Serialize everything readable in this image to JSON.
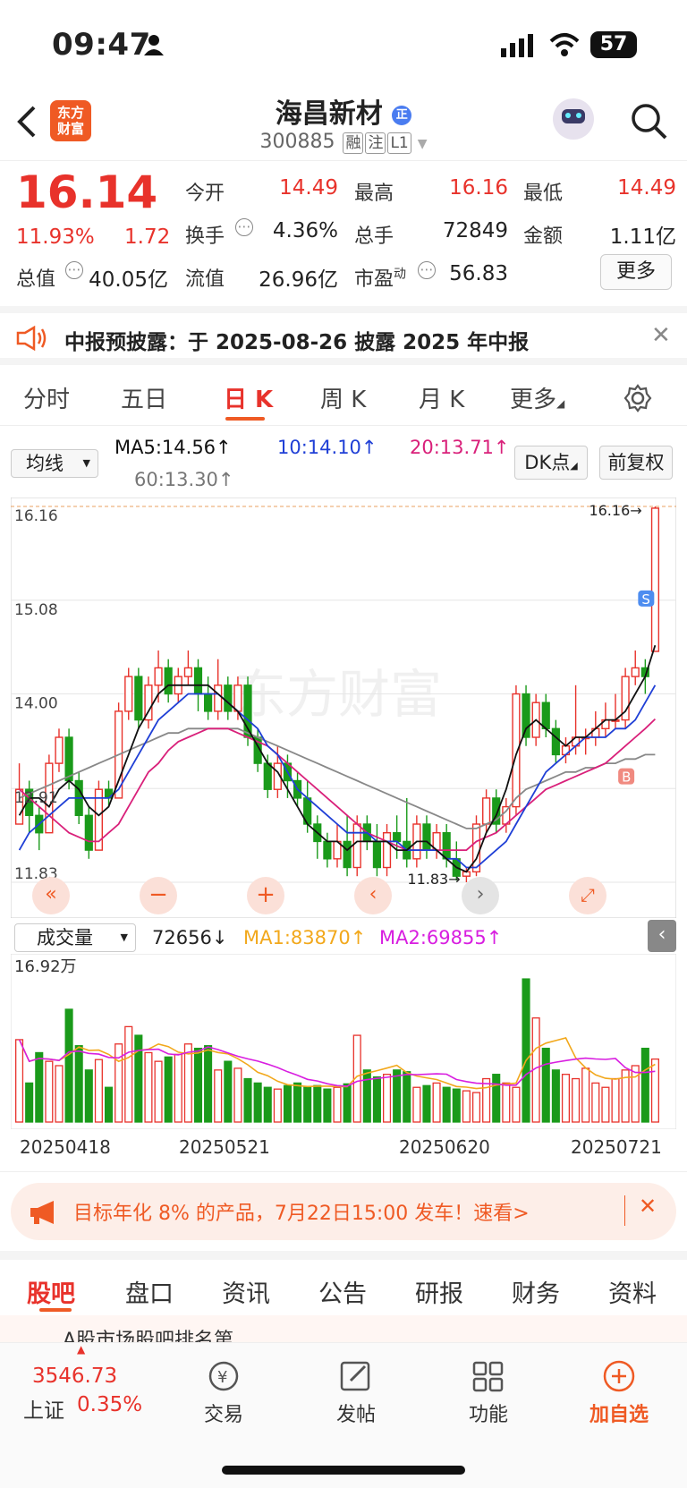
{
  "status": {
    "time": "09:47",
    "battery": "57"
  },
  "header": {
    "logo_line1": "东方",
    "logo_line2": "财富",
    "title": "海昌新材",
    "code": "300885",
    "tags": [
      "融",
      "注",
      "L1"
    ]
  },
  "quote": {
    "price": "16.14",
    "change_pct": "11.93%",
    "change": "1.72",
    "open_label": "今开",
    "open": "14.49",
    "high_label": "最高",
    "high": "16.16",
    "low_label": "最低",
    "low": "14.49",
    "turnover_label": "换手",
    "turnover": "4.36%",
    "volume_label": "总手",
    "volume": "72849",
    "amount_label": "金额",
    "amount": "1.11亿",
    "mktcap_label": "总值",
    "mktcap": "40.05亿",
    "float_label": "流值",
    "float_cap": "26.96亿",
    "pe_label": "市盈",
    "pe_sup": "动",
    "pe": "56.83",
    "more_label": "更多"
  },
  "notice": {
    "text": "中报预披露：于 2025-08-26 披露 2025 年中报"
  },
  "chart_tabs": [
    "分时",
    "五日",
    "日 K",
    "周 K",
    "月 K",
    "更多"
  ],
  "ma_panel": {
    "selector": "均线",
    "ma5": "MA5:14.56",
    "ma10": "10:14.10",
    "ma20": "20:13.71",
    "ma60": "60:13.30",
    "dk_button": "DK点",
    "adjust_button": "前复权"
  },
  "kline": {
    "y_ticks": [
      "16.16",
      "15.08",
      "14.00",
      "12.91",
      "11.83"
    ],
    "high_marker": "16.16",
    "low_marker": "11.83",
    "watermark": "东方财富"
  },
  "volume_panel": {
    "selector": "成交量",
    "value": "72656",
    "ma1": "MA1:83870",
    "ma2": "MA2:69855",
    "y_max": "16.92万",
    "dates": [
      "20250418",
      "20250521",
      "20250620",
      "20250721"
    ]
  },
  "promo": {
    "text": "目标年化 8% 的产品，7月22日15:00 发车！速看>"
  },
  "bottom_tabs": [
    "股吧",
    "盘口",
    "资讯",
    "公告",
    "研报",
    "财务",
    "资料"
  ],
  "peek_text": "A股市场股吧排名第",
  "bottom_bar": {
    "index_value": "3546.73",
    "index_name": "上证",
    "index_pct": "0.35%",
    "items": [
      "交易",
      "发帖",
      "功能",
      "加自选"
    ]
  },
  "colors": {
    "up": "#e8322b",
    "down": "#1a9a1a",
    "accent": "#ef5a24",
    "ma5": "#111111",
    "ma10": "#1f3fd6",
    "ma20": "#d9207a",
    "ma60": "#888888"
  },
  "chart_data": {
    "type": "candlestick",
    "ylim": [
      11.83,
      16.16
    ],
    "candles": [
      [
        12.5,
        12.9,
        12.5,
        13.2
      ],
      [
        12.9,
        12.6,
        12.4,
        13.0
      ],
      [
        12.6,
        12.4,
        12.2,
        12.7
      ],
      [
        12.4,
        13.2,
        12.4,
        13.3
      ],
      [
        13.2,
        13.5,
        13.1,
        13.6
      ],
      [
        13.5,
        13.0,
        12.9,
        13.6
      ],
      [
        13.0,
        12.6,
        12.5,
        13.1
      ],
      [
        12.6,
        12.2,
        12.1,
        12.7
      ],
      [
        12.2,
        12.9,
        12.2,
        13.0
      ],
      [
        12.9,
        12.8,
        12.7,
        13.0
      ],
      [
        12.8,
        13.8,
        12.8,
        13.9
      ],
      [
        13.8,
        14.2,
        13.7,
        14.3
      ],
      [
        14.2,
        13.7,
        13.6,
        14.3
      ],
      [
        13.7,
        14.1,
        13.6,
        14.2
      ],
      [
        14.1,
        14.3,
        13.9,
        14.5
      ],
      [
        14.3,
        14.0,
        13.9,
        14.4
      ],
      [
        14.0,
        14.2,
        13.9,
        14.3
      ],
      [
        14.2,
        14.3,
        14.1,
        14.5
      ],
      [
        14.3,
        14.0,
        13.8,
        14.4
      ],
      [
        14.0,
        13.8,
        13.7,
        14.2
      ],
      [
        13.8,
        14.1,
        13.7,
        14.4
      ],
      [
        14.1,
        13.8,
        13.7,
        14.2
      ],
      [
        13.8,
        14.1,
        13.7,
        14.2
      ],
      [
        14.1,
        13.5,
        13.4,
        14.2
      ],
      [
        13.5,
        13.2,
        13.1,
        13.6
      ],
      [
        13.2,
        12.9,
        12.8,
        13.3
      ],
      [
        12.9,
        13.2,
        12.8,
        13.4
      ],
      [
        13.2,
        13.0,
        12.8,
        13.3
      ],
      [
        13.0,
        12.8,
        12.7,
        13.1
      ],
      [
        12.8,
        12.5,
        12.4,
        13.0
      ],
      [
        12.5,
        12.3,
        12.1,
        12.6
      ],
      [
        12.3,
        12.1,
        12.0,
        12.4
      ],
      [
        12.1,
        12.3,
        12.0,
        12.5
      ],
      [
        12.3,
        12.0,
        11.9,
        12.6
      ],
      [
        12.0,
        12.5,
        11.9,
        12.6
      ],
      [
        12.5,
        12.3,
        12.2,
        12.6
      ],
      [
        12.3,
        12.0,
        11.9,
        12.5
      ],
      [
        12.0,
        12.4,
        11.9,
        12.5
      ],
      [
        12.4,
        12.3,
        12.1,
        12.6
      ],
      [
        12.3,
        12.1,
        12.0,
        12.8
      ],
      [
        12.1,
        12.5,
        12.0,
        12.6
      ],
      [
        12.5,
        12.2,
        12.1,
        12.6
      ],
      [
        12.2,
        12.4,
        12.1,
        12.5
      ],
      [
        12.4,
        12.1,
        12.0,
        12.5
      ],
      [
        12.1,
        11.9,
        11.85,
        12.3
      ],
      [
        11.9,
        11.95,
        11.83,
        12.0
      ],
      [
        11.95,
        12.5,
        11.9,
        12.6
      ],
      [
        12.5,
        12.8,
        12.4,
        12.9
      ],
      [
        12.8,
        12.5,
        12.4,
        12.9
      ],
      [
        12.5,
        12.7,
        12.4,
        12.8
      ],
      [
        12.7,
        14.0,
        12.6,
        14.1
      ],
      [
        14.0,
        13.5,
        13.4,
        14.1
      ],
      [
        13.5,
        13.9,
        13.4,
        14.0
      ],
      [
        13.9,
        13.6,
        13.5,
        14.0
      ],
      [
        13.6,
        13.3,
        13.2,
        13.7
      ],
      [
        13.3,
        13.4,
        13.2,
        13.5
      ],
      [
        13.4,
        13.5,
        13.3,
        14.1
      ],
      [
        13.5,
        13.5,
        13.3,
        13.6
      ],
      [
        13.5,
        13.6,
        13.4,
        13.8
      ],
      [
        13.6,
        13.7,
        13.5,
        13.9
      ],
      [
        13.7,
        13.7,
        13.6,
        14.0
      ],
      [
        13.7,
        14.2,
        13.6,
        14.3
      ],
      [
        14.2,
        14.3,
        14.1,
        14.5
      ],
      [
        14.3,
        14.2,
        14.0,
        14.4
      ],
      [
        14.49,
        16.14,
        14.49,
        16.16
      ]
    ],
    "ma5": [
      12.6,
      12.8,
      12.8,
      12.7,
      12.9,
      13.0,
      12.9,
      12.7,
      12.6,
      12.7,
      13.0,
      13.3,
      13.6,
      13.8,
      14.0,
      14.1,
      14.1,
      14.1,
      14.1,
      14.1,
      14.0,
      13.9,
      13.8,
      13.6,
      13.4,
      13.2,
      13.1,
      12.9,
      12.7,
      12.5,
      12.4,
      12.3,
      12.3,
      12.2,
      12.3,
      12.3,
      12.3,
      12.3,
      12.2,
      12.2,
      12.3,
      12.3,
      12.2,
      12.1,
      12.0,
      11.95,
      12.1,
      12.4,
      12.6,
      12.9,
      13.3,
      13.6,
      13.7,
      13.6,
      13.5,
      13.4,
      13.5,
      13.5,
      13.6,
      13.7,
      13.7,
      13.8,
      14.0,
      14.2,
      14.56
    ],
    "ma10": [
      12.2,
      12.4,
      12.5,
      12.6,
      12.7,
      12.8,
      12.8,
      12.8,
      12.8,
      12.8,
      12.9,
      13.1,
      13.3,
      13.5,
      13.7,
      13.8,
      13.9,
      14.0,
      14.0,
      14.0,
      14.0,
      13.9,
      13.8,
      13.7,
      13.6,
      13.4,
      13.3,
      13.1,
      12.9,
      12.8,
      12.7,
      12.6,
      12.5,
      12.4,
      12.4,
      12.4,
      12.3,
      12.3,
      12.3,
      12.2,
      12.2,
      12.2,
      12.2,
      12.1,
      12.1,
      12.0,
      12.0,
      12.1,
      12.2,
      12.3,
      12.5,
      12.7,
      12.9,
      13.1,
      13.2,
      13.3,
      13.4,
      13.5,
      13.5,
      13.5,
      13.6,
      13.6,
      13.7,
      13.9,
      14.1
    ],
    "ma20": [
      12.9,
      12.8,
      12.7,
      12.6,
      12.5,
      12.4,
      12.35,
      12.3,
      12.3,
      12.4,
      12.5,
      12.7,
      12.9,
      13.1,
      13.2,
      13.35,
      13.45,
      13.5,
      13.55,
      13.6,
      13.6,
      13.6,
      13.55,
      13.5,
      13.45,
      13.4,
      13.3,
      13.2,
      13.1,
      13.0,
      12.9,
      12.8,
      12.7,
      12.6,
      12.5,
      12.4,
      12.35,
      12.3,
      12.25,
      12.2,
      12.2,
      12.2,
      12.2,
      12.2,
      12.2,
      12.2,
      12.3,
      12.35,
      12.4,
      12.5,
      12.6,
      12.7,
      12.8,
      12.9,
      12.95,
      13.0,
      13.05,
      13.1,
      13.15,
      13.2,
      13.3,
      13.4,
      13.5,
      13.6,
      13.71
    ],
    "ma60": [
      12.8,
      12.85,
      12.9,
      12.95,
      13.0,
      13.05,
      13.1,
      13.15,
      13.2,
      13.25,
      13.3,
      13.35,
      13.4,
      13.45,
      13.5,
      13.55,
      13.55,
      13.6,
      13.6,
      13.6,
      13.6,
      13.6,
      13.6,
      13.55,
      13.5,
      13.45,
      13.4,
      13.35,
      13.3,
      13.25,
      13.2,
      13.15,
      13.1,
      13.05,
      13.0,
      12.95,
      12.9,
      12.85,
      12.8,
      12.75,
      12.7,
      12.65,
      12.6,
      12.55,
      12.5,
      12.45,
      12.45,
      12.5,
      12.55,
      12.65,
      12.8,
      12.9,
      12.95,
      13.0,
      13.05,
      13.1,
      13.1,
      13.15,
      13.15,
      13.2,
      13.2,
      13.25,
      13.25,
      13.3,
      13.3
    ],
    "volume_max": 169200,
    "volumes": [
      95,
      45,
      80,
      70,
      65,
      130,
      88,
      60,
      72,
      40,
      90,
      110,
      100,
      80,
      70,
      75,
      78,
      90,
      85,
      88,
      60,
      70,
      62,
      50,
      45,
      40,
      38,
      42,
      45,
      40,
      42,
      38,
      40,
      44,
      100,
      60,
      52,
      55,
      60,
      58,
      40,
      42,
      45,
      40,
      38,
      36,
      34,
      50,
      55,
      45,
      40,
      165,
      120,
      85,
      60,
      55,
      50,
      62,
      45,
      40,
      50,
      60,
      65,
      85,
      72.6
    ]
  }
}
